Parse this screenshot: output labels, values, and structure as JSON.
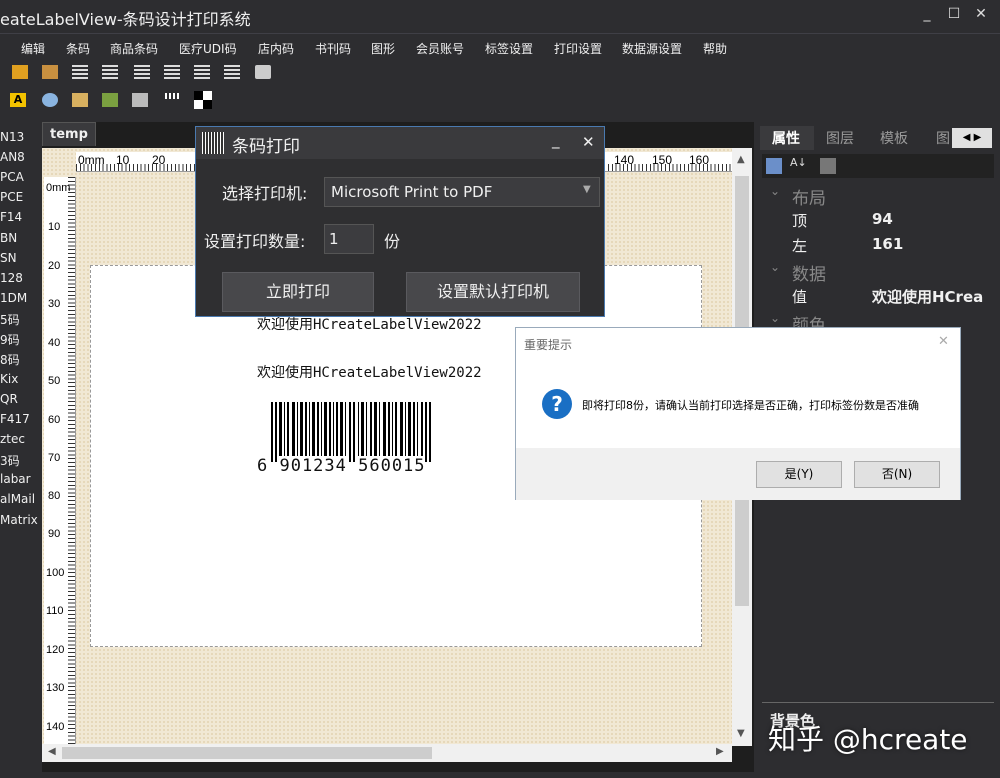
{
  "window": {
    "title": "eateLabelView-条码设计打印系统",
    "min": "_",
    "max": "☐",
    "close": "✕"
  },
  "menu": [
    "编辑",
    "条码",
    "商品条码",
    "医疗UDI码",
    "店内码",
    "书刊码",
    "图形",
    "会员账号",
    "标签设置",
    "打印设置",
    "数据源设置",
    "帮助"
  ],
  "left_list": [
    "N13",
    "AN8",
    "PCA",
    "PCE",
    "F14",
    "BN",
    "SN",
    "128",
    "1DM",
    "5码",
    "9码",
    "8码",
    "Kix",
    "QR",
    "F417",
    "ztec",
    "3码",
    "labar",
    "alMail",
    "Matrix"
  ],
  "doc": {
    "tab": "temp",
    "hruler": [
      "0mm",
      "10",
      "20",
      "140",
      "150",
      "160"
    ],
    "vruler": [
      "0mm",
      "10",
      "20",
      "30",
      "40",
      "50",
      "60",
      "70",
      "80",
      "90",
      "100",
      "110",
      "120",
      "130",
      "140"
    ],
    "label_text": [
      "欢迎使用HCreateLabelView2022",
      "欢迎使用HCreateLabelView2022"
    ],
    "barcode_digits": "6 901234 560015"
  },
  "print_dialog": {
    "title": "条码打印",
    "printer_label": "选择打印机:",
    "printer_value": "Microsoft Print to PDF",
    "qty_label": "设置打印数量:",
    "qty_value": "1",
    "qty_unit": "份",
    "print_btn": "立即打印",
    "default_btn": "设置默认打印机",
    "min": "_",
    "close": "✕"
  },
  "message_box": {
    "title": "重要提示",
    "message": "即将打印8份，请确认当前打印选择是否正确，打印标签份数是否准确",
    "yes": "是(Y)",
    "no": "否(N)",
    "close": "✕"
  },
  "right_panel": {
    "tabs": [
      "属性",
      "图层",
      "模板",
      "图"
    ],
    "groups": {
      "layout": "布局",
      "data": "数据",
      "color": "颜色"
    },
    "props": [
      {
        "name": "顶",
        "value": "94"
      },
      {
        "name": "左",
        "value": "161"
      },
      {
        "name": "值",
        "value": "欢迎使用HCrea"
      }
    ],
    "bottom": "背景色"
  },
  "watermark": "知乎 @hcreate",
  "colors": {
    "accent": "#4a7ab0",
    "question_icon": "#1a6fc4"
  }
}
